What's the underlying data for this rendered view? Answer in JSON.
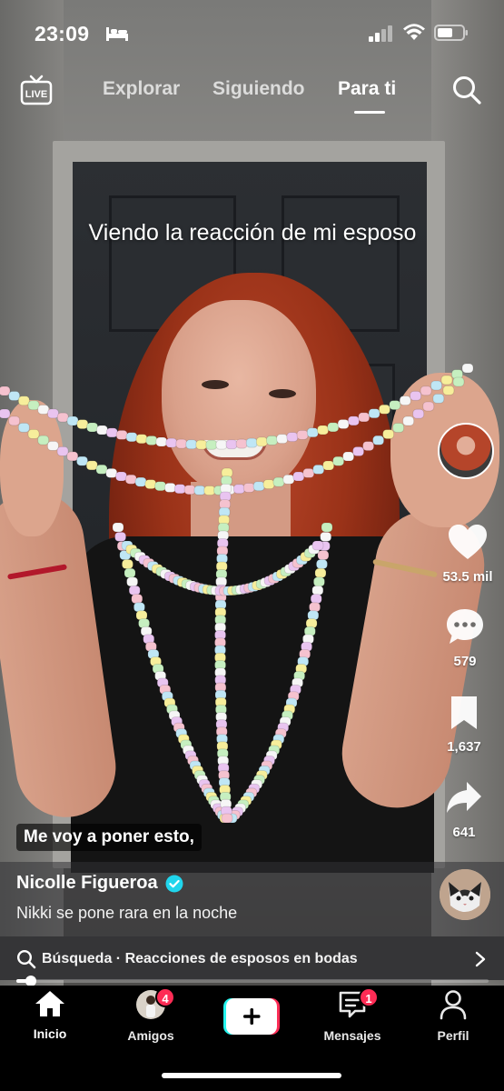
{
  "status_bar": {
    "time": "23:09",
    "icons": [
      "bed-icon",
      "signal-icon",
      "wifi-icon",
      "battery-icon"
    ]
  },
  "top_nav": {
    "live_label": "LIVE",
    "tabs": [
      {
        "label": "Explorar",
        "active": false
      },
      {
        "label": "Siguiendo",
        "active": false
      },
      {
        "label": "Para ti",
        "active": true
      }
    ]
  },
  "video": {
    "caption_top": "Viendo la reacción de mi esposo",
    "subtitle": "Me voy a poner esto,"
  },
  "actions": {
    "likes": "53.5 mil",
    "comments": "579",
    "saves": "1,637",
    "shares": "641"
  },
  "post": {
    "username": "Nicolle Figueroa",
    "verified": true,
    "description": "Nikki se pone rara en la noche"
  },
  "search_bar": {
    "label": "Búsqueda · Reacciones de esposos en bodas"
  },
  "playback": {
    "progress": 0.03
  },
  "bottom_nav": {
    "items": [
      {
        "label": "Inicio",
        "icon": "home-icon",
        "active": true
      },
      {
        "label": "Amigos",
        "icon": "friends-avatar",
        "badge": "4"
      },
      {
        "label": "",
        "icon": "add-icon"
      },
      {
        "label": "Mensajes",
        "icon": "inbox-icon",
        "badge": "1"
      },
      {
        "label": "Perfil",
        "icon": "profile-icon"
      }
    ]
  },
  "colors": {
    "accent_red": "#fe2c55",
    "accent_cyan": "#25f4ee",
    "verified_blue": "#20d5ec",
    "nav_background": "#000000",
    "search_bar_background": "#353537"
  }
}
